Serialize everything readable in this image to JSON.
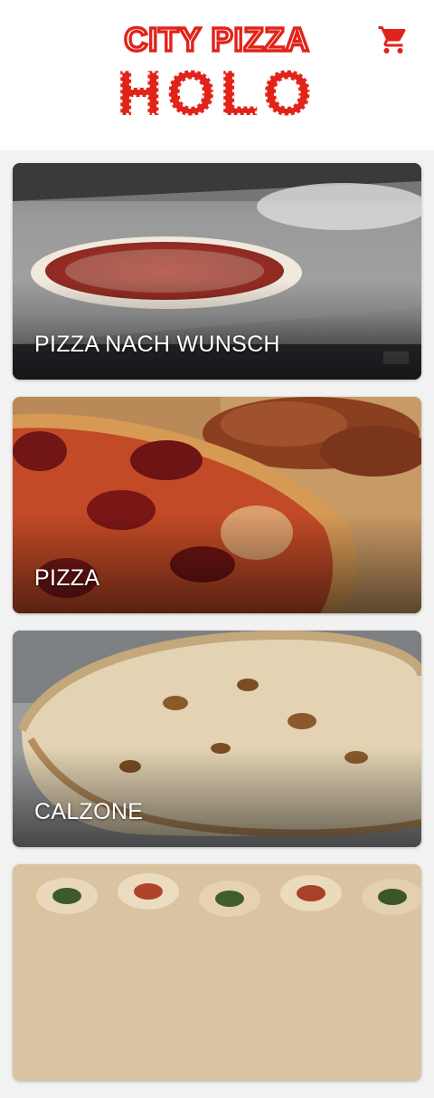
{
  "header": {
    "logo_line1": "CITY PIZZA",
    "logo_line2": "HOLO",
    "cart_icon": "shopping-cart-icon",
    "accent_color": "#e2231a"
  },
  "categories": [
    {
      "label": "PIZZA NACH WUNSCH",
      "image": "pizza-dough-photo"
    },
    {
      "label": "PIZZA",
      "image": "pepperoni-pizza-photo"
    },
    {
      "label": "CALZONE",
      "image": "calzone-photo"
    },
    {
      "label": "",
      "image": "rolls-photo"
    }
  ]
}
